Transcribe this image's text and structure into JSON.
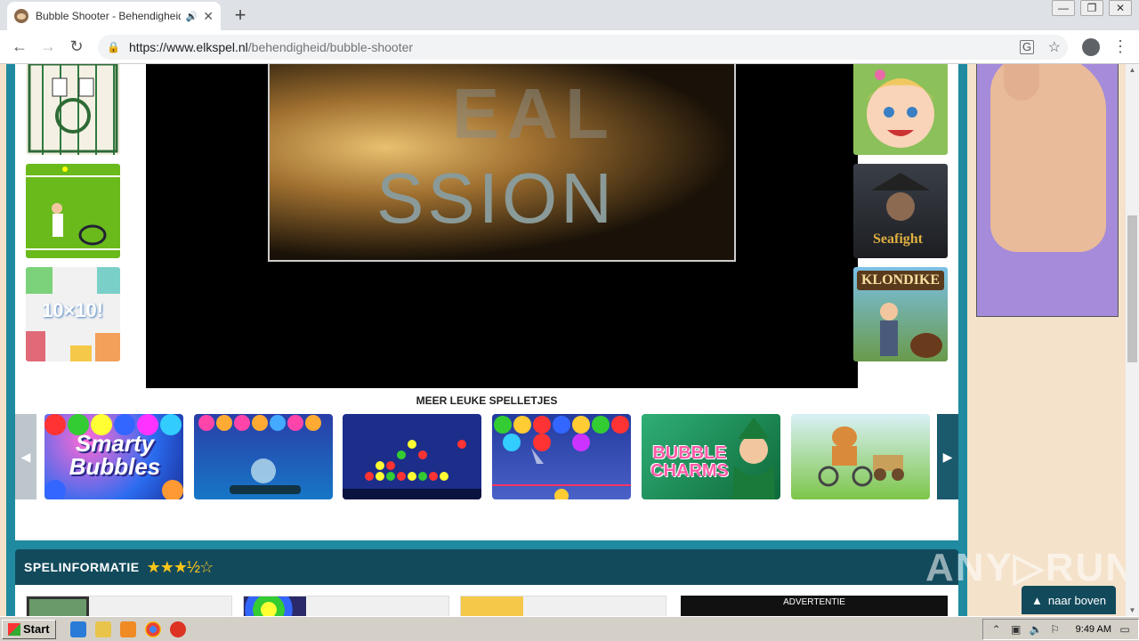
{
  "browser": {
    "tab_title": "Bubble Shooter - Behendigheid",
    "tab_audio_icon": "speaker-icon",
    "url_host": "https://www.elkspel.nl",
    "url_path": "/behendigheid/bubble-shooter"
  },
  "page": {
    "more_games_label": "MEER LEUKE SPELLETJES",
    "video_text_line1": "EAL",
    "video_text_line2": "SSION",
    "info_title": "SPELINFORMATIE",
    "info_stars": "★★★½☆",
    "ad_label": "ADVERTENTIE",
    "back_to_top": "naar boven",
    "watermark": "ANY▷RUN",
    "left_thumbs": [
      "mahjong",
      "tennis",
      "10x10"
    ],
    "right_thumbs": [
      "baby-hazel",
      "seafight",
      "klondike"
    ],
    "right_thumb_labels": {
      "seafight": "Seafight",
      "klondike": "KLONDIKE",
      "tenxten": "10×10!"
    },
    "carousel": [
      {
        "name": "smarty-bubbles",
        "label": "Smarty Bubbles"
      },
      {
        "name": "bubble-game-2",
        "label": ""
      },
      {
        "name": "bubble-game-3",
        "label": ""
      },
      {
        "name": "bubble-game-4",
        "label": ""
      },
      {
        "name": "bubble-charms",
        "label": "BUBBLE CHARMS"
      },
      {
        "name": "cat-cart-game",
        "label": ""
      }
    ]
  },
  "taskbar": {
    "start_label": "Start",
    "clock": "9:49 AM"
  }
}
